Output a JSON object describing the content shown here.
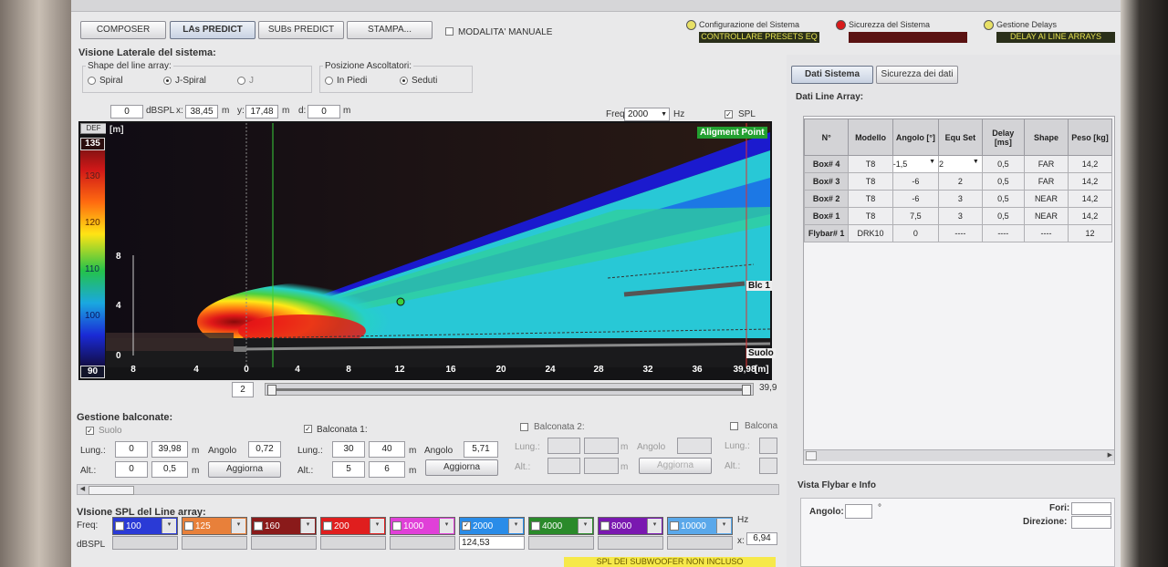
{
  "tabs": {
    "composer": "COMPOSER",
    "las_predict": "LAs PREDICT",
    "subs_predict": "SUBs PREDICT",
    "stampa": "STAMPA..."
  },
  "manual_mode": {
    "label": "MODALITA' MANUALE"
  },
  "status": [
    {
      "label": "Configurazione del Sistema",
      "value": "CONTROLLARE PRESETS EQ",
      "led_color": "#e8e066"
    },
    {
      "label": "Sicurezza del Sistema",
      "value": "",
      "led_color": "#d81a1a"
    },
    {
      "label": "Gestione Delays",
      "value": "DELAY AI LINE ARRAYS",
      "led_color": "#e8e066"
    }
  ],
  "side": {
    "title": "Visione Laterale del sistema:",
    "shape_label": "Shape del line array:",
    "shape_options": [
      "Spiral",
      "J-Spiral",
      "J"
    ],
    "listener_label": "Posizione Ascoltatori:",
    "listener_options": [
      "In Piedi",
      "Seduti"
    ]
  },
  "readout": {
    "dbspl": "0",
    "dbspl_label": "dBSPL",
    "x_label": "x:",
    "x": "38,45",
    "x_unit": "m",
    "y_label": "y:",
    "y": "17,48",
    "y_unit": "m",
    "d_label": "d:",
    "d": "0",
    "d_unit": "m",
    "freq_label": "Freq",
    "freq": "2000",
    "freq_unit": "Hz",
    "spl_label": "SPL"
  },
  "plot": {
    "def_label": "DEF",
    "scale_max": "135",
    "scale_min": "90",
    "scale_ticks": [
      "130",
      "120",
      "110",
      "100"
    ],
    "unit_m": "[m]",
    "y_ticks": [
      "8",
      "4",
      "0"
    ],
    "x_ticks": [
      "8",
      "4",
      "0",
      "4",
      "8",
      "12",
      "16",
      "20",
      "24",
      "28",
      "32",
      "36",
      "39,98"
    ],
    "alignment": "Aligment Point",
    "blc": "Blc 1",
    "suolo": "Suolo",
    "slider_left": "2",
    "slider_right": "39,9"
  },
  "balconate": {
    "title": "Gestione balconate:",
    "suolo": {
      "label": "Suolo",
      "lung_label": "Lung.:",
      "lung_a": "0",
      "lung_b": "39,98",
      "unit": "m",
      "angolo_label": "Angolo",
      "angolo": "0,72",
      "alt_label": "Alt.:",
      "alt_a": "0",
      "alt_b": "0,5",
      "aggiorna": "Aggiorna"
    },
    "b1": {
      "label": "Balconata 1:",
      "lung_label": "Lung.:",
      "lung_a": "30",
      "lung_b": "40",
      "unit": "m",
      "angolo_label": "Angolo",
      "angolo": "5,71",
      "alt_label": "Alt.:",
      "alt_a": "5",
      "alt_b": "6",
      "aggiorna": "Aggiorna"
    },
    "b2": {
      "label": "Balconata 2:",
      "lung_label": "Lung.:",
      "unit": "m",
      "angolo_label": "Angolo",
      "alt_label": "Alt.:",
      "aggiorna": "Aggiorna"
    },
    "b3": {
      "label": "Balcona",
      "lung_label": "Lung.:",
      "alt_label": "Alt.:"
    }
  },
  "spl_bands": {
    "title": "VIsione SPL del Line array:",
    "freq_label": "Freq:",
    "dbspl_label": "dBSPL",
    "hz": "Hz",
    "x_label": "x:",
    "x_value": "6,94",
    "bands": [
      {
        "label": "100",
        "color": "#2a3ad6",
        "checked": false
      },
      {
        "label": "125",
        "color": "#e8803a",
        "checked": false
      },
      {
        "label": "160",
        "color": "#8a1a1a",
        "checked": false
      },
      {
        "label": "200",
        "color": "#e01e1e",
        "checked": false
      },
      {
        "label": "1000",
        "color": "#e040d8",
        "checked": false
      },
      {
        "label": "2000",
        "color": "#2a8ce8",
        "checked": true,
        "value": "124,53"
      },
      {
        "label": "4000",
        "color": "#2a8a2a",
        "checked": false
      },
      {
        "label": "8000",
        "color": "#7a18b0",
        "checked": false
      },
      {
        "label": "10000",
        "color": "#5aa8ea",
        "checked": false
      }
    ],
    "bottom_note": "SPL DEI SUBWOOFER NON INCLUSO"
  },
  "right": {
    "tab_system": "Dati Sistema",
    "tab_safety": "Sicurezza dei dati",
    "la_title": "Dati Line Array:",
    "columns": [
      "N°",
      "Modello",
      "Angolo [°]",
      "Equ Set",
      "Delay [ms]",
      "Shape",
      "Peso [kg]"
    ],
    "rows": [
      [
        "Box# 4",
        "T8",
        "-1,5",
        "2",
        "0,5",
        "FAR",
        "14,2"
      ],
      [
        "Box# 3",
        "T8",
        "-6",
        "2",
        "0,5",
        "FAR",
        "14,2"
      ],
      [
        "Box# 2",
        "T8",
        "-6",
        "3",
        "0,5",
        "NEAR",
        "14,2"
      ],
      [
        "Box# 1",
        "T8",
        "7,5",
        "3",
        "0,5",
        "NEAR",
        "14,2"
      ],
      [
        "Flybar# 1",
        "DRK10",
        "0",
        "----",
        "----",
        "----",
        "12"
      ]
    ],
    "flybar_title": "Vista Flybar e Info",
    "angolo_label": "Angolo:",
    "angolo_unit": "°",
    "fori_label": "Fori:",
    "direzione_label": "Direzione:"
  }
}
